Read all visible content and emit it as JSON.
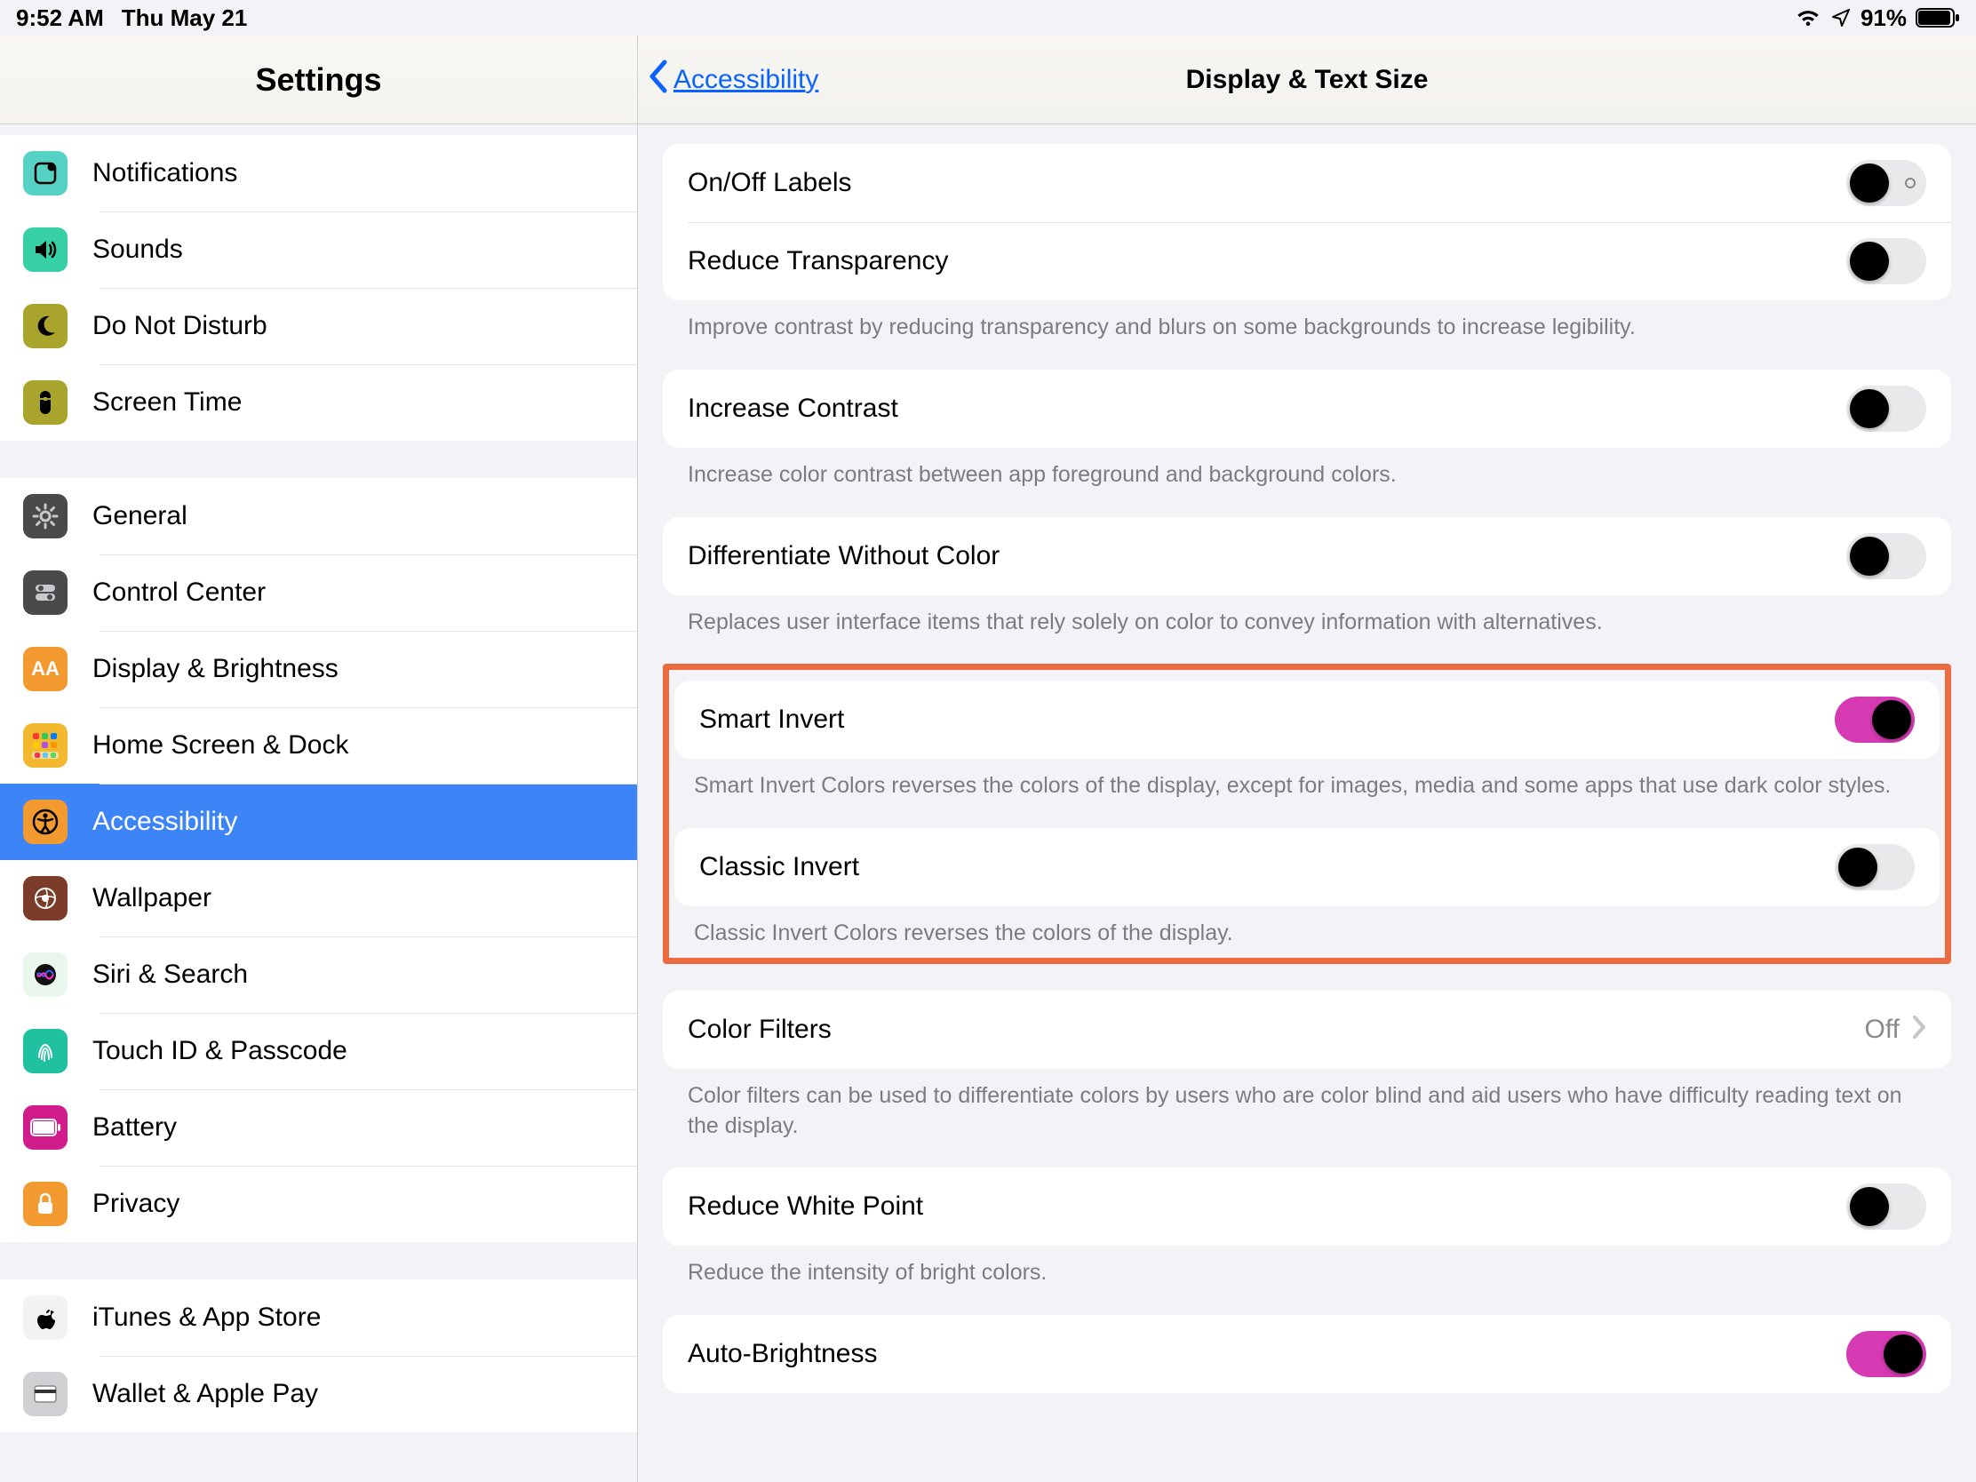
{
  "status": {
    "time": "9:52 AM",
    "date": "Thu May 21",
    "battery_pct": "91%"
  },
  "sidebar": {
    "title": "Settings",
    "groups": [
      {
        "items": [
          {
            "id": "notifications",
            "label": "Notifications"
          },
          {
            "id": "sounds",
            "label": "Sounds"
          },
          {
            "id": "dnd",
            "label": "Do Not Disturb"
          },
          {
            "id": "screentime",
            "label": "Screen Time"
          }
        ]
      },
      {
        "items": [
          {
            "id": "general",
            "label": "General"
          },
          {
            "id": "controlcenter",
            "label": "Control Center"
          },
          {
            "id": "display",
            "label": "Display & Brightness"
          },
          {
            "id": "homedock",
            "label": "Home Screen & Dock"
          },
          {
            "id": "accessibility",
            "label": "Accessibility",
            "selected": true
          },
          {
            "id": "wallpaper",
            "label": "Wallpaper"
          },
          {
            "id": "siri",
            "label": "Siri & Search"
          },
          {
            "id": "touchid",
            "label": "Touch ID & Passcode"
          },
          {
            "id": "battery",
            "label": "Battery"
          },
          {
            "id": "privacy",
            "label": "Privacy"
          }
        ]
      },
      {
        "items": [
          {
            "id": "itunes",
            "label": "iTunes & App Store"
          },
          {
            "id": "wallet",
            "label": "Wallet & Apple Pay"
          }
        ]
      }
    ]
  },
  "detail": {
    "back_label": "Accessibility",
    "title": "Display & Text Size",
    "rows": {
      "onoff": {
        "label": "On/Off Labels",
        "on": false,
        "indicator": true
      },
      "reducetrans": {
        "label": "Reduce Transparency",
        "on": false,
        "footer": "Improve contrast by reducing transparency and blurs on some backgrounds to increase legibility."
      },
      "contrast": {
        "label": "Increase Contrast",
        "on": false,
        "footer": "Increase color contrast between app foreground and background colors."
      },
      "diffcolor": {
        "label": "Differentiate Without Color",
        "on": false,
        "footer": "Replaces user interface items that rely solely on color to convey information with alternatives."
      },
      "smartinvert": {
        "label": "Smart Invert",
        "on": true,
        "footer": "Smart Invert Colors reverses the colors of the display, except for images, media and some apps that use dark color styles."
      },
      "classicinvert": {
        "label": "Classic Invert",
        "on": false,
        "footer": "Classic Invert Colors reverses the colors of the display."
      },
      "colorfilters": {
        "label": "Color Filters",
        "value": "Off",
        "footer": "Color filters can be used to differentiate colors by users who are color blind and aid users who have difficulty reading text on the display."
      },
      "whitepoint": {
        "label": "Reduce White Point",
        "on": false,
        "footer": "Reduce the intensity of bright colors."
      },
      "autobright": {
        "label": "Auto-Brightness",
        "on": true
      }
    }
  }
}
